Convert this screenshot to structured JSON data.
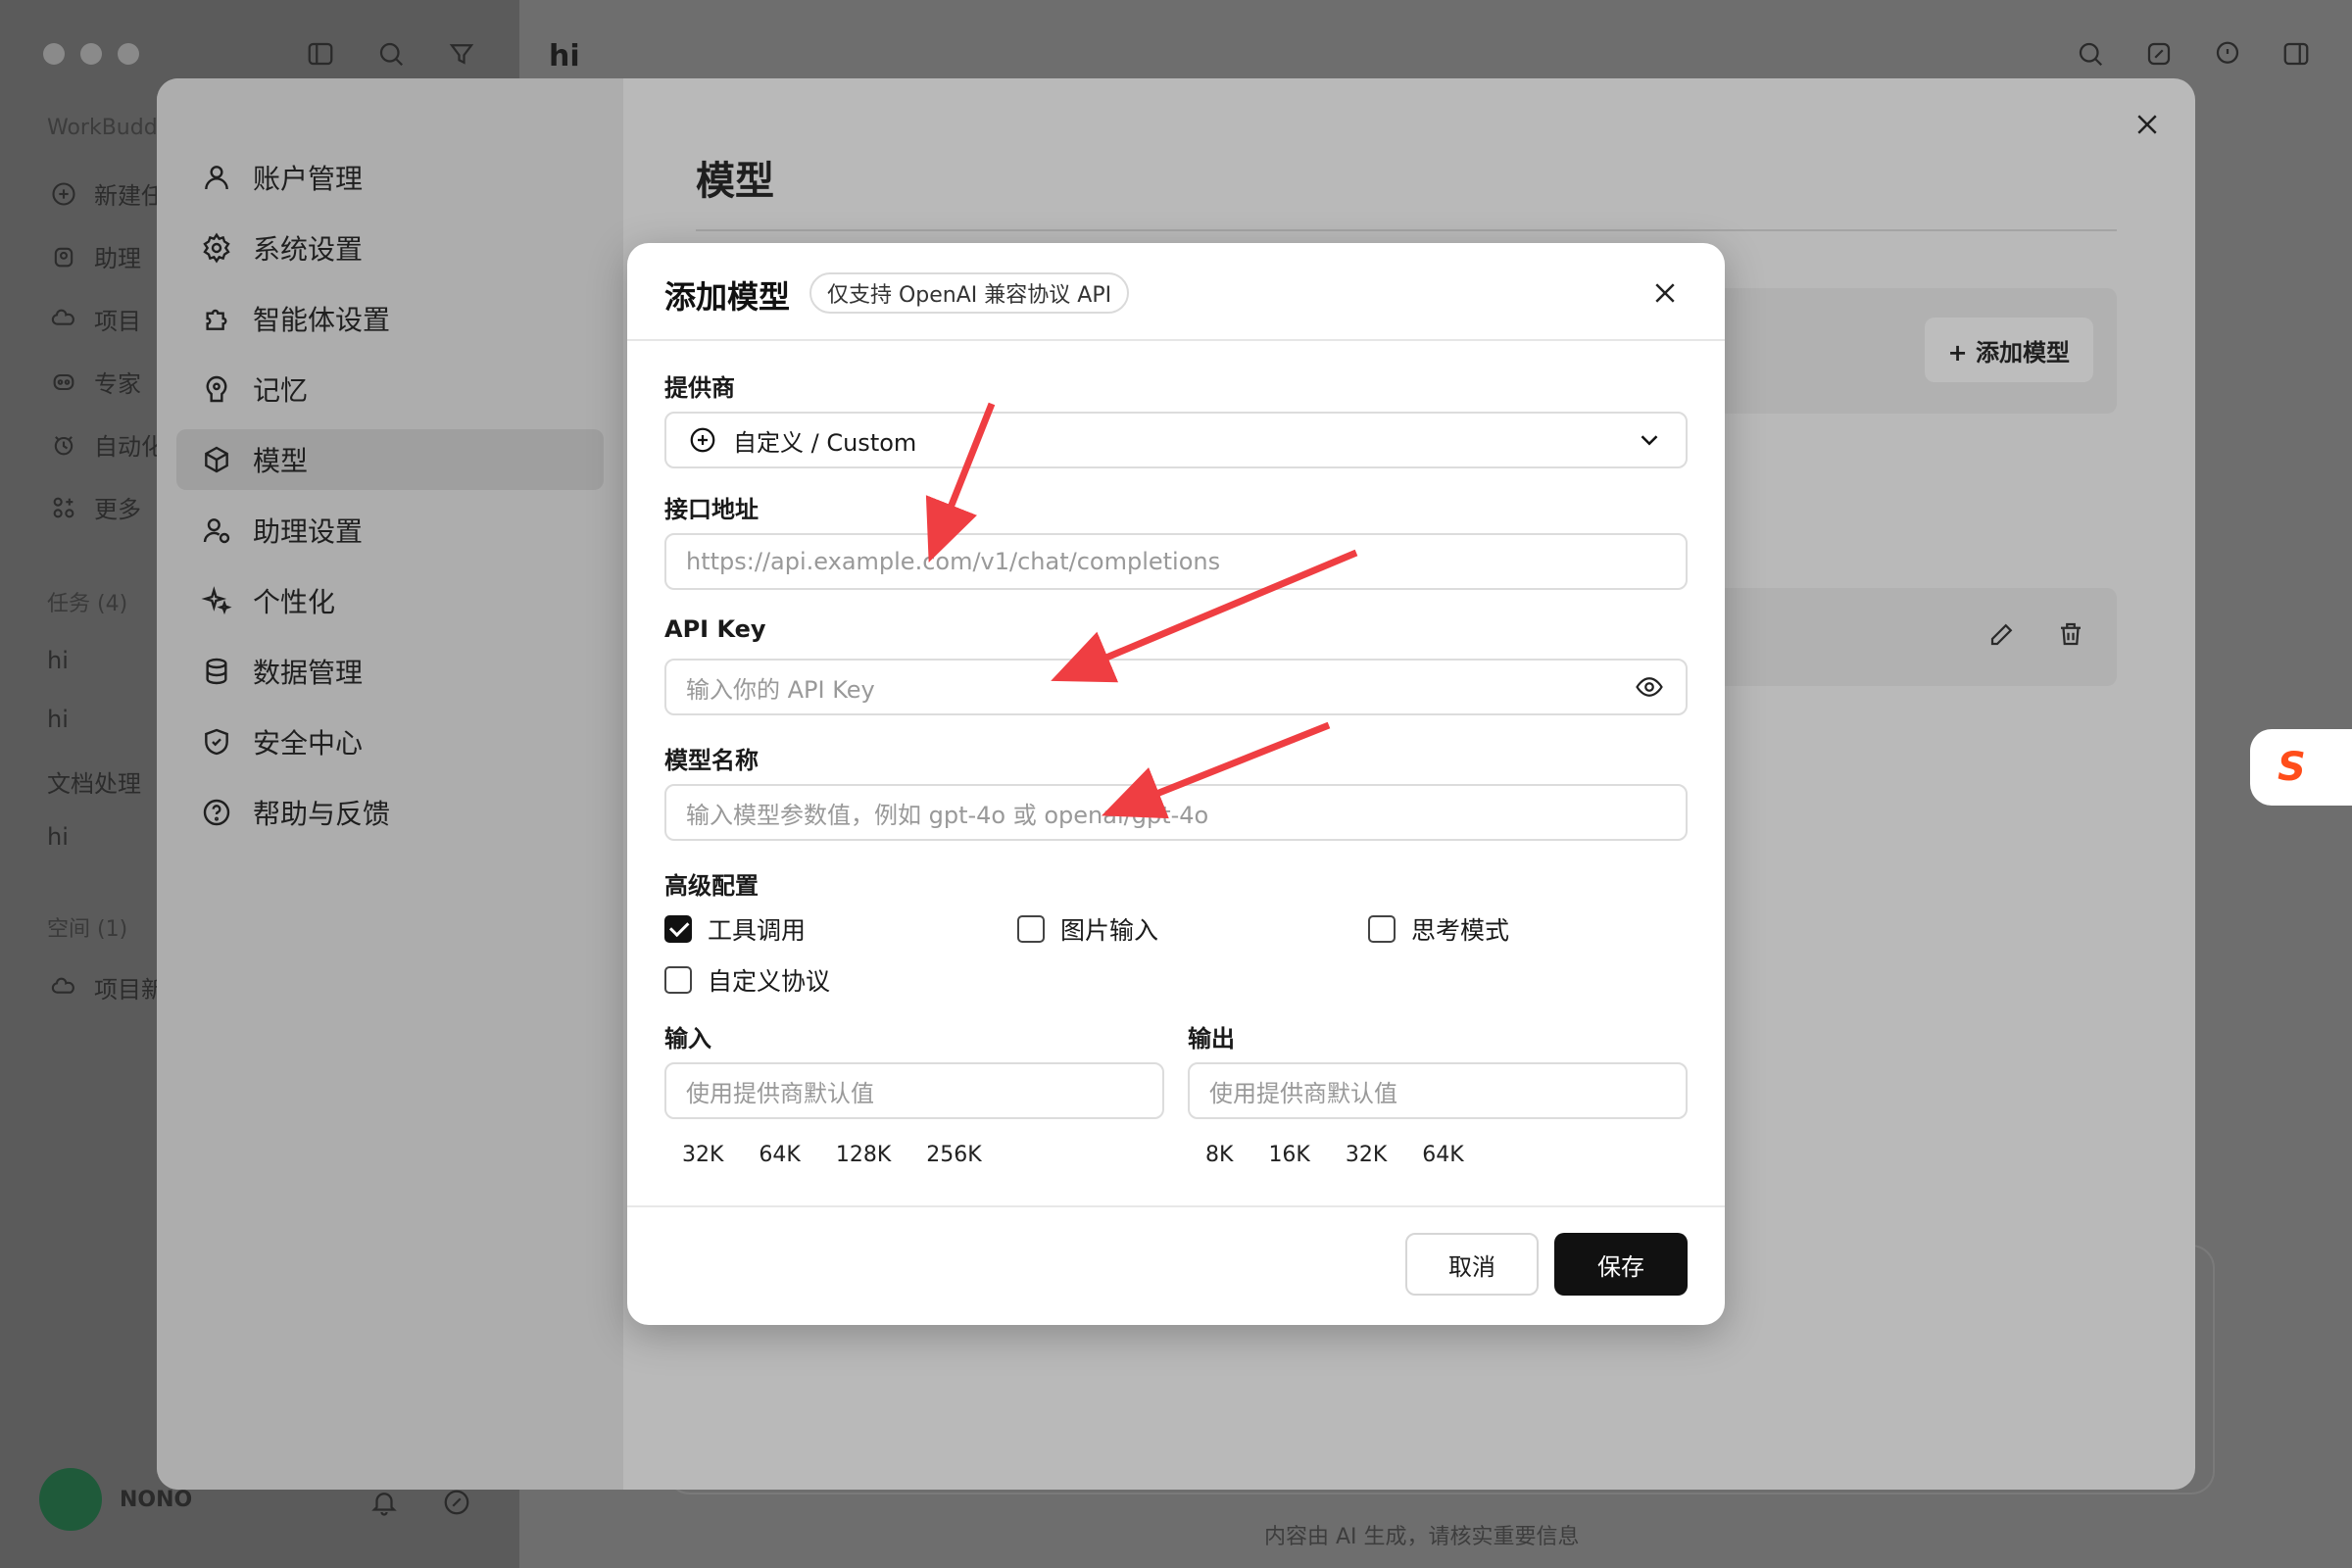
{
  "app": {
    "chat_title": "hi",
    "brand": "WorkBudd",
    "sidebar_items": [
      {
        "label": "新建任",
        "icon": "plus-circle-icon"
      },
      {
        "label": "助理",
        "icon": "assistant-icon"
      },
      {
        "label": "项目",
        "icon": "project-icon"
      },
      {
        "label": "专家",
        "icon": "expert-icon"
      },
      {
        "label": "自动化",
        "icon": "automation-icon"
      },
      {
        "label": "更多",
        "icon": "more-icon"
      }
    ],
    "tasks_section": "任务 (4)",
    "tasks": [
      "hi",
      "hi",
      "文档处理",
      "hi"
    ],
    "space_section": "空间 (1)",
    "space_item": "项目新",
    "user_name": "NONO",
    "footer_note": "内容由 AI 生成，请核实重要信息"
  },
  "settings": {
    "nav": [
      {
        "label": "账户管理",
        "icon": "user-icon"
      },
      {
        "label": "系统设置",
        "icon": "gear-icon"
      },
      {
        "label": "智能体设置",
        "icon": "puzzle-icon"
      },
      {
        "label": "记忆",
        "icon": "memory-icon"
      },
      {
        "label": "模型",
        "icon": "cube-icon",
        "active": true
      },
      {
        "label": "助理设置",
        "icon": "assistant-settings-icon"
      },
      {
        "label": "个性化",
        "icon": "sparkle-icon"
      },
      {
        "label": "数据管理",
        "icon": "database-icon"
      },
      {
        "label": "安全中心",
        "icon": "shield-icon"
      },
      {
        "label": "帮助与反馈",
        "icon": "help-icon"
      }
    ],
    "title": "模型",
    "add_model_label": "+ 添加模型"
  },
  "modal": {
    "title": "添加模型",
    "badge": "仅支持 OpenAI 兼容协议 API",
    "provider_label": "提供商",
    "provider_value": "自定义 / Custom",
    "endpoint_label": "接口地址",
    "endpoint_placeholder": "https://api.example.com/v1/chat/completions",
    "apikey_label": "API Key",
    "apikey_placeholder": "输入你的 API Key",
    "model_name_label": "模型名称",
    "model_name_placeholder": "输入模型参数值，例如 gpt-4o 或 openai/gpt-4o",
    "advanced_label": "高级配置",
    "checkboxes": [
      {
        "label": "工具调用",
        "checked": true
      },
      {
        "label": "图片输入",
        "checked": false
      },
      {
        "label": "思考模式",
        "checked": false
      },
      {
        "label": "自定义协议",
        "checked": false
      }
    ],
    "input_label": "输入",
    "output_label": "输出",
    "input_placeholder": "使用提供商默认值",
    "output_placeholder": "使用提供商默认值",
    "input_chips": [
      "32K",
      "64K",
      "128K",
      "256K"
    ],
    "output_chips": [
      "8K",
      "16K",
      "32K",
      "64K"
    ],
    "cancel_label": "取消",
    "save_label": "保存"
  },
  "colors": {
    "accent_arrow": "#ef3e42",
    "primary_button": "#111111",
    "sogou_brand": "#ff4d1a"
  }
}
